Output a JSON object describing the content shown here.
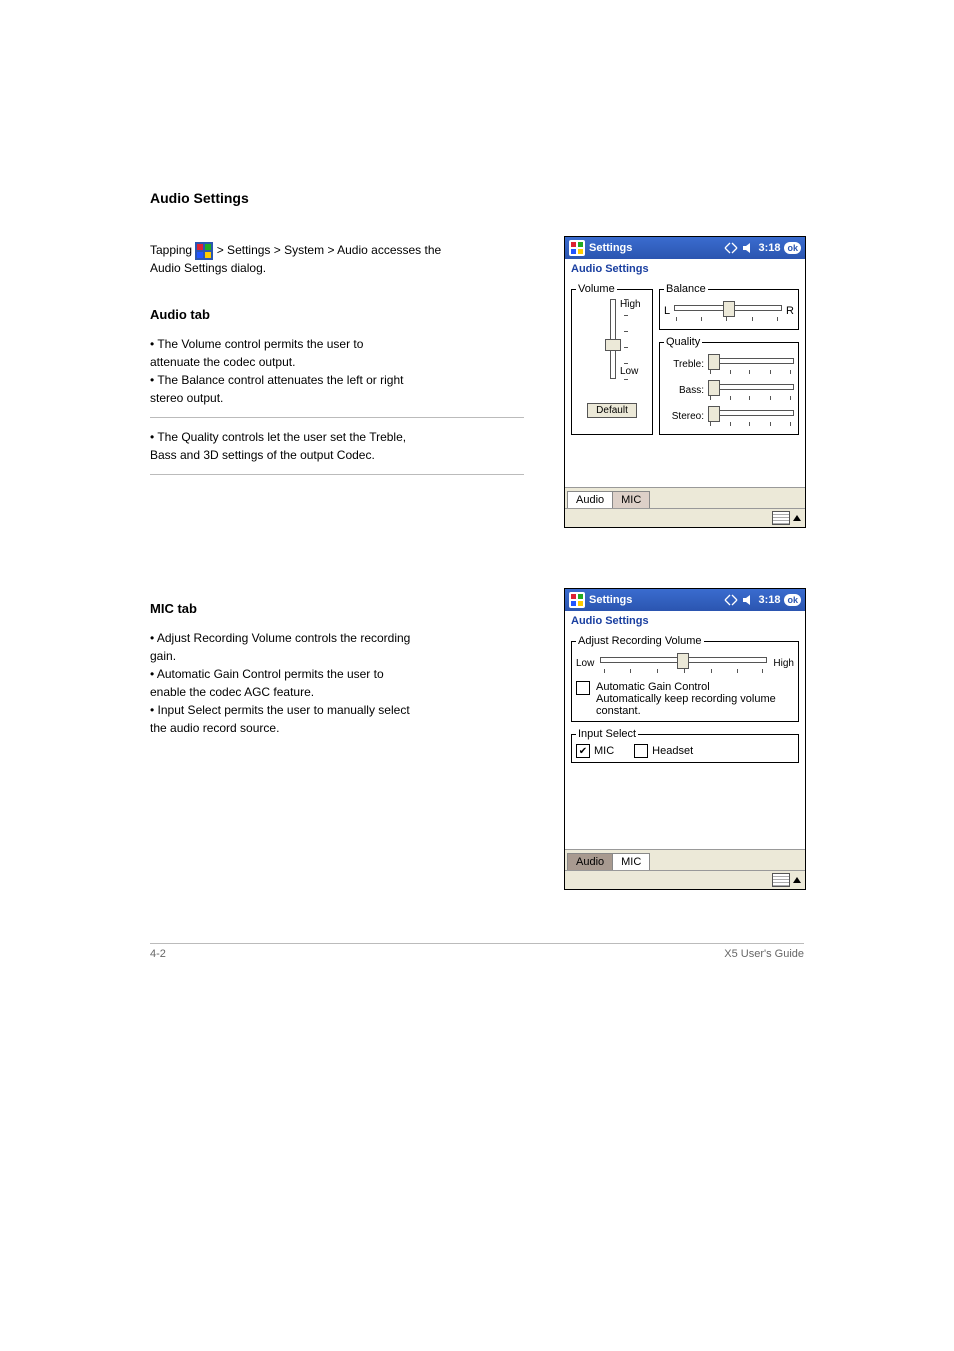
{
  "header": {
    "section_title": "Audio Settings"
  },
  "intro": {
    "line1_pre": "Tapping ",
    "line1_post": " > Settings > System > Audio accesses the",
    "line2": "Audio Settings dialog."
  },
  "audio_tab_section": {
    "title": "Audio tab",
    "desc_lines": [
      "• The Volume control permits the user to",
      "  attenuate the codec output.",
      "• The Balance control attenuates the left or right",
      "  stereo output.",
      "• The Quality controls let the user set the Treble,",
      "  Bass and 3D settings of the output Codec."
    ]
  },
  "mic_tab_section": {
    "title": "MIC tab",
    "desc_lines": [
      "• Adjust Recording Volume controls the recording",
      "  gain.",
      "• Automatic Gain Control permits the user to",
      "  enable the codec AGC feature.",
      "• Input Select permits the user to manually select",
      "  the audio record source."
    ]
  },
  "screenshots": {
    "audio": {
      "titlebar": {
        "title": "Settings",
        "time": "3:18",
        "ok": "ok"
      },
      "subtitle": "Audio Settings",
      "volume": {
        "legend": "Volume",
        "high": "High",
        "low": "Low",
        "default_btn": "Default"
      },
      "balance": {
        "legend": "Balance",
        "left": "L",
        "right": "R"
      },
      "quality": {
        "legend": "Quality",
        "treble": "Treble:",
        "bass": "Bass:",
        "stereo": "Stereo:"
      },
      "tabs": {
        "audio": "Audio",
        "mic": "MIC"
      }
    },
    "mic": {
      "titlebar": {
        "title": "Settings",
        "time": "3:18",
        "ok": "ok"
      },
      "subtitle": "Audio Settings",
      "arv": {
        "legend": "Adjust Recording Volume",
        "low": "Low",
        "high": "High"
      },
      "agc": {
        "label": "Automatic Gain Control",
        "desc": "Automatically keep recording volume constant."
      },
      "input_select": {
        "legend": "Input Select",
        "mic": "MIC",
        "headset": "Headset"
      },
      "tabs": {
        "audio": "Audio",
        "mic": "MIC"
      }
    }
  },
  "footer": {
    "page": "4-2",
    "doc": "X5 User's Guide"
  }
}
